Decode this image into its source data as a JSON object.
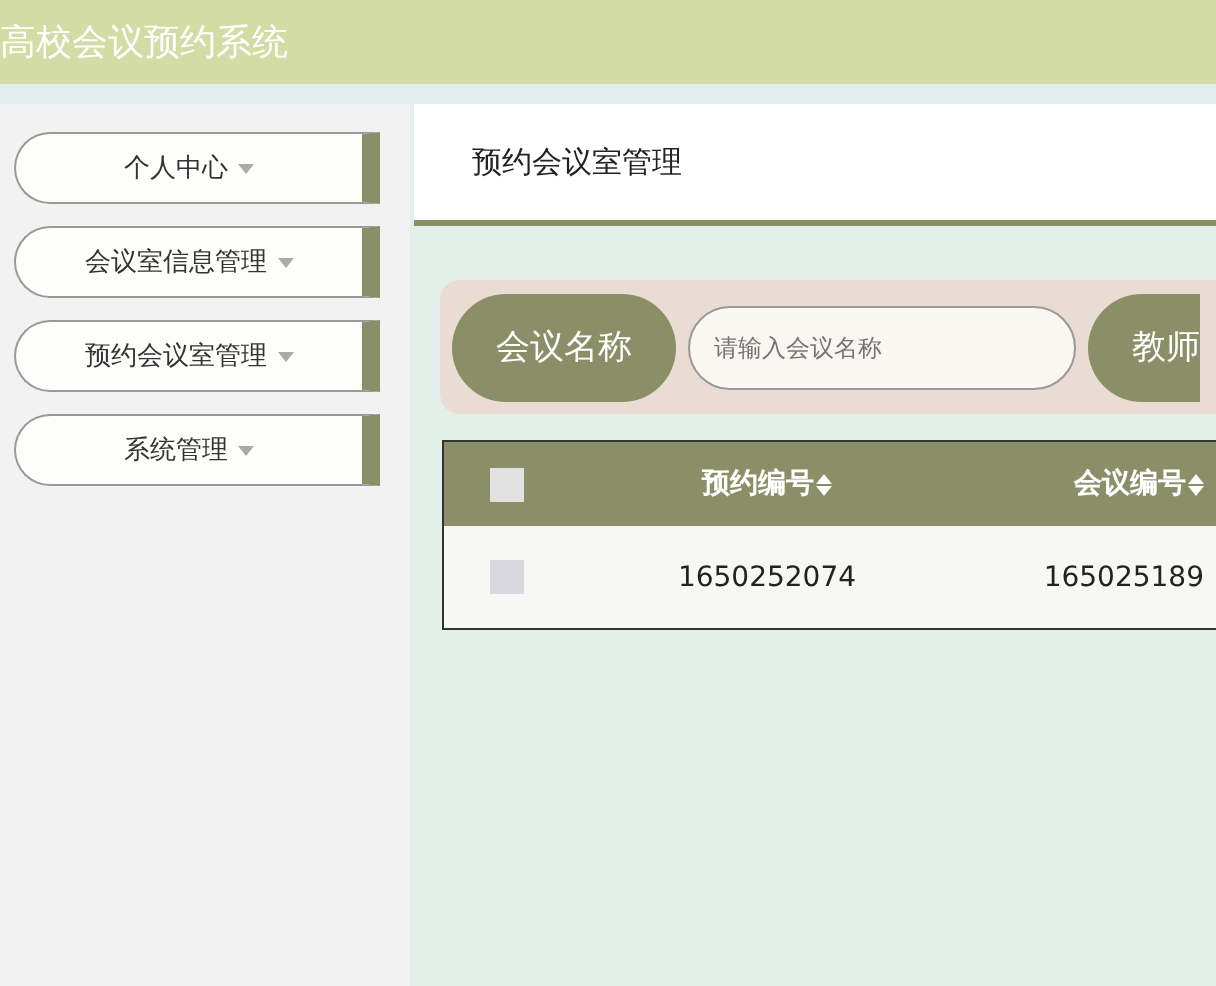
{
  "header": {
    "title": "高校会议预约系统"
  },
  "sidebar": {
    "items": [
      {
        "label": "个人中心"
      },
      {
        "label": "会议室信息管理"
      },
      {
        "label": "预约会议室管理"
      },
      {
        "label": "系统管理"
      }
    ]
  },
  "main": {
    "title": "预约会议室管理",
    "search": {
      "labels": [
        "会议名称",
        "教师"
      ],
      "placeholder": "请输入会议名称"
    },
    "table": {
      "columns": [
        "预约编号",
        "会议编号"
      ],
      "header_checked": false,
      "rows": [
        {
          "checked": false,
          "cells": [
            "1650252074",
            "165025189"
          ]
        }
      ]
    }
  }
}
